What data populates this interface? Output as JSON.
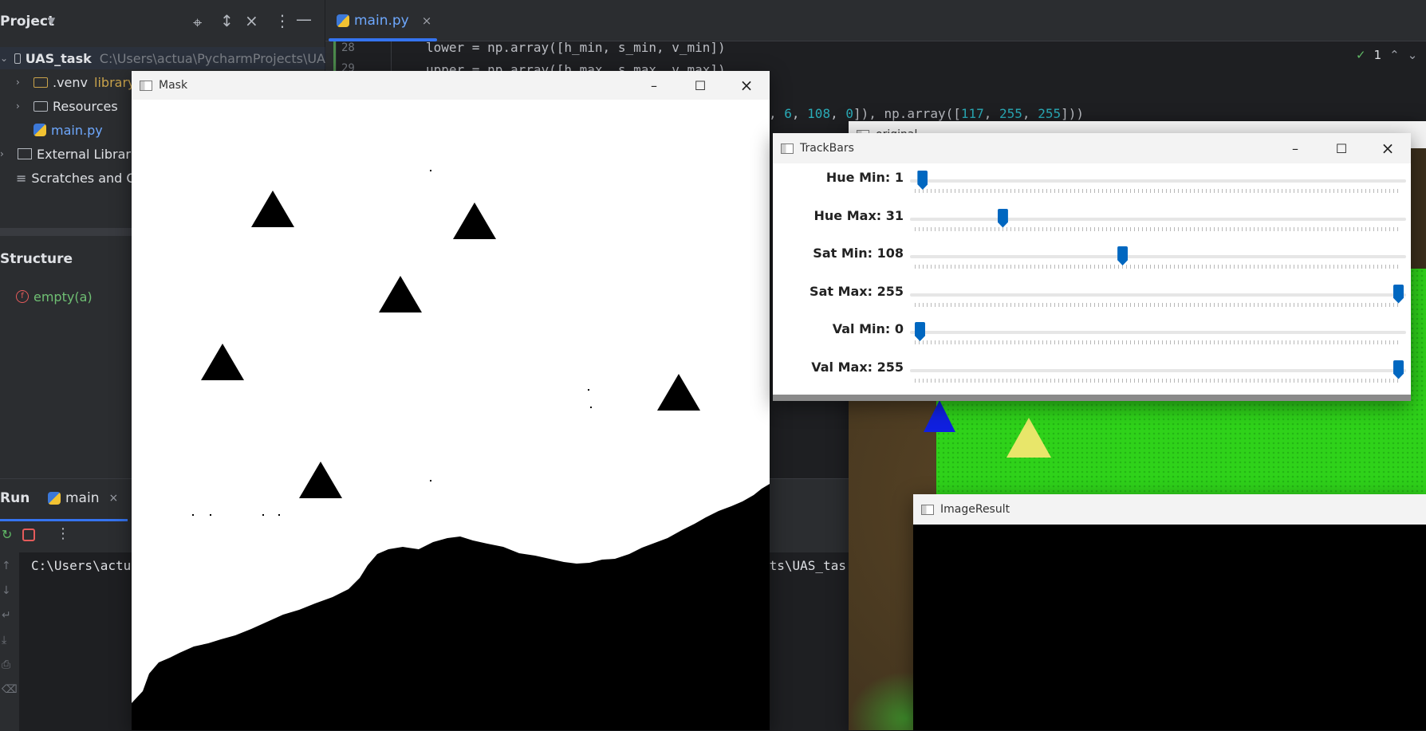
{
  "ide": {
    "project_panel": {
      "title": "Project",
      "tree": {
        "root_name": "UAS_task",
        "root_path": "C:\\Users\\actua\\PycharmProjects\\UA",
        "venv_name": ".venv",
        "venv_note": "library",
        "resources": "Resources",
        "main_file": "main.py",
        "external": "External Librarie",
        "scratches": "Scratches and C"
      }
    },
    "structure_panel": {
      "title": "Structure",
      "item": "empty(a)"
    },
    "editor": {
      "tab_label": "main.py",
      "tab_close": "×",
      "line_28": "28",
      "line_29": "29",
      "code_line_1": "lower = np.array([h_min, s_min, v_min])",
      "code_line_2": "upper = np.array([h_max, s_max, v_max])",
      "code_line_3_pre": ", ",
      "code_line_3_a": "6",
      "code_line_3_b": "108",
      "code_line_3_c": "0",
      "code_line_3_mid": "]), np.array([",
      "code_line_3_d": "117",
      "code_line_3_e": "255",
      "code_line_3_f": "255",
      "code_line_3_end": "]))",
      "inspection_count": "1"
    },
    "run_panel": {
      "title": "Run",
      "tab": "main",
      "console_line_left": "C:\\Users\\actu",
      "console_line_right": "cts\\UAS_tas"
    }
  },
  "windows": {
    "mask": {
      "title": "Mask"
    },
    "original": {
      "title": "original"
    },
    "trackbars": {
      "title": "TrackBars",
      "sliders": [
        {
          "label": "Hue Min: 1",
          "value": 1,
          "max": 179
        },
        {
          "label": "Hue Max: 31",
          "value": 31,
          "max": 179
        },
        {
          "label": "Sat Min: 108",
          "value": 108,
          "max": 255
        },
        {
          "label": "Sat Max: 255",
          "value": 255,
          "max": 255
        },
        {
          "label": "Val Min: 0",
          "value": 0,
          "max": 255
        },
        {
          "label": "Val Max: 255",
          "value": 255,
          "max": 255
        }
      ]
    },
    "image_result": {
      "title": "ImageResult"
    }
  },
  "colors": {
    "ide_bg": "#1e1f22",
    "panel_bg": "#2b2d30",
    "accent": "#3574f0",
    "slider_thumb": "#0067c0",
    "grass_green": "#2fd21a",
    "triangle_yellow": "#e8e66a"
  }
}
